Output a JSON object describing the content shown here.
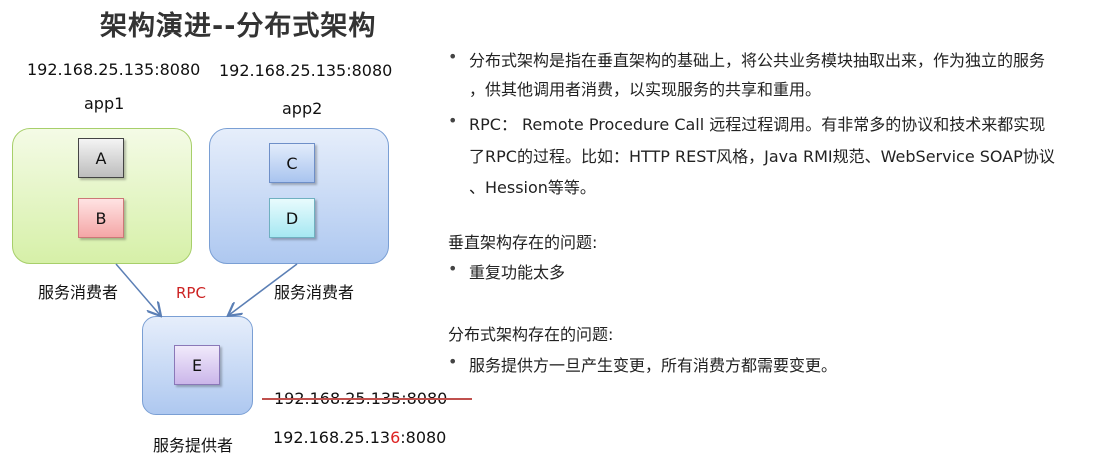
{
  "title": "架构演进--分布式架构",
  "diagram": {
    "app1": {
      "ip": "192.168.25.135:8080",
      "label": "app1",
      "modules": [
        "A",
        "B"
      ],
      "caption": "服务消费者"
    },
    "app2": {
      "ip": "192.168.25.135:8080",
      "label": "app2",
      "modules": [
        "C",
        "D"
      ],
      "caption": "服务消费者"
    },
    "rpc_label": "RPC",
    "provider": {
      "module": "E",
      "caption": "服务提供者",
      "old_ip": "192.168.25.135:8080",
      "new_ip_prefix": "192.168.25.13",
      "new_ip_changed": "6",
      "new_ip_suffix": ":8080"
    },
    "colors": {
      "rpc": "#cc2222",
      "strike": "#c0504d",
      "arrow": "#5b7fb5"
    }
  },
  "notes": {
    "bullet1": [
      "分布式架构是指在垂直架构的基础上，将公共业务模块抽取出来，作为独立的服务",
      "，供其他调用者消费，以实现服务的共享和重用。"
    ],
    "bullet2": [
      "RPC： Remote Procedure Call 远程过程调用。有非常多的协议和技术来都实现",
      "了RPC的过程。比如：HTTP REST风格，Java RMI规范、WebService SOAP协议",
      "、Hession等等。"
    ],
    "vertical_heading": "垂直架构存在的问题:",
    "vertical_items": [
      "重复功能太多"
    ],
    "distributed_heading": "分布式架构存在的问题:",
    "distributed_items": [
      "服务提供方一旦产生变更，所有消费方都需要变更。"
    ]
  }
}
